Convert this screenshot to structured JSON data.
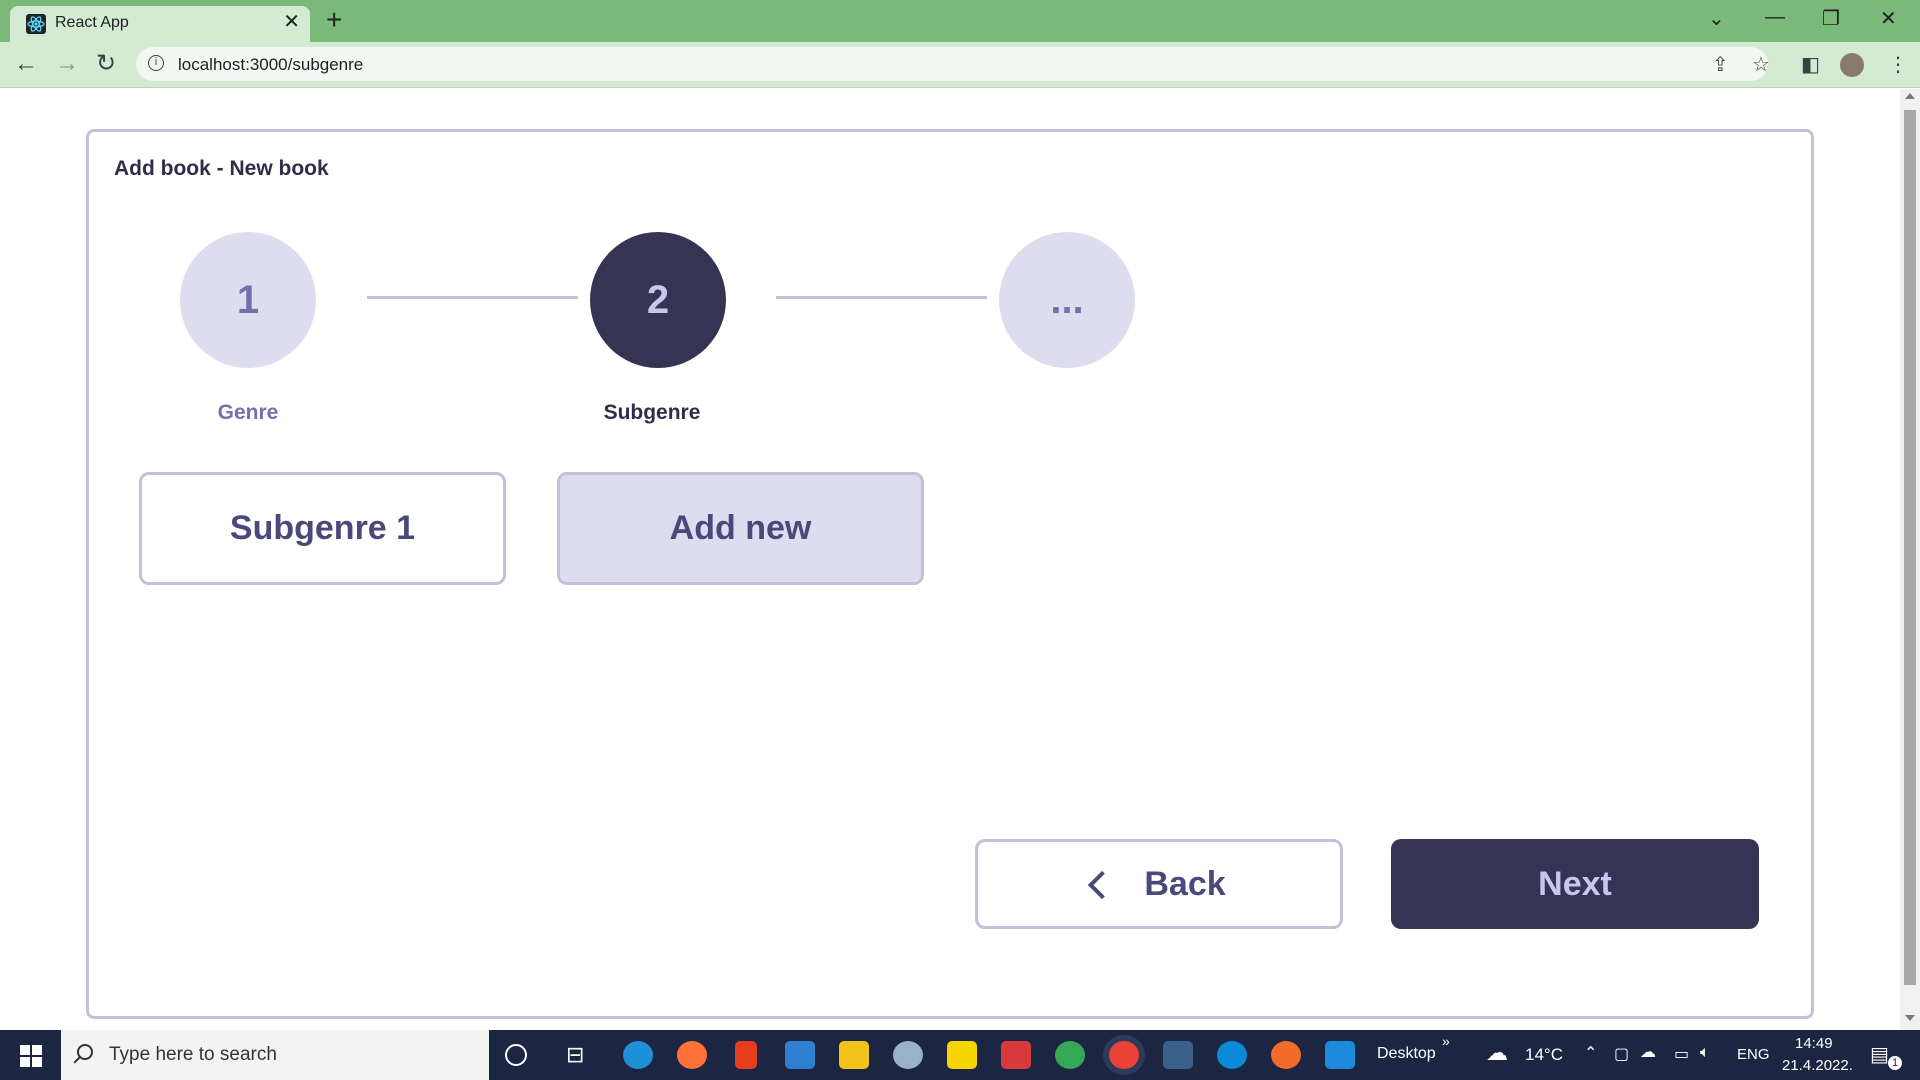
{
  "browser": {
    "tab_title": "React App",
    "tab_close": "✕",
    "new_tab": "+",
    "url": "localhost:3000/subgenre",
    "window_controls": {
      "dropdown": "⌄",
      "minimize": "—",
      "restore": "❐",
      "close": "✕"
    }
  },
  "page": {
    "title": "Add book - New book",
    "steps": [
      {
        "number": "1",
        "label": "Genre",
        "state": "completed"
      },
      {
        "number": "2",
        "label": "Subgenre",
        "state": "active"
      },
      {
        "number": "...",
        "label": "",
        "state": "pending"
      }
    ],
    "options": [
      {
        "label": "Subgenre 1"
      },
      {
        "label": "Add new"
      }
    ],
    "back_label": "Back",
    "next_label": "Next"
  },
  "colors": {
    "accent_dark": "#353453",
    "accent_light": "#deddef",
    "border": "#c3c1d9",
    "chrome_green": "#7ab97a"
  },
  "taskbar": {
    "search_placeholder": "Type here to search",
    "desktop_label": "Desktop",
    "desktop_chevron": "»",
    "weather": "14°C",
    "language": "ENG",
    "time": "14:49",
    "date": "21.4.2022.",
    "notifications_count": "1"
  }
}
